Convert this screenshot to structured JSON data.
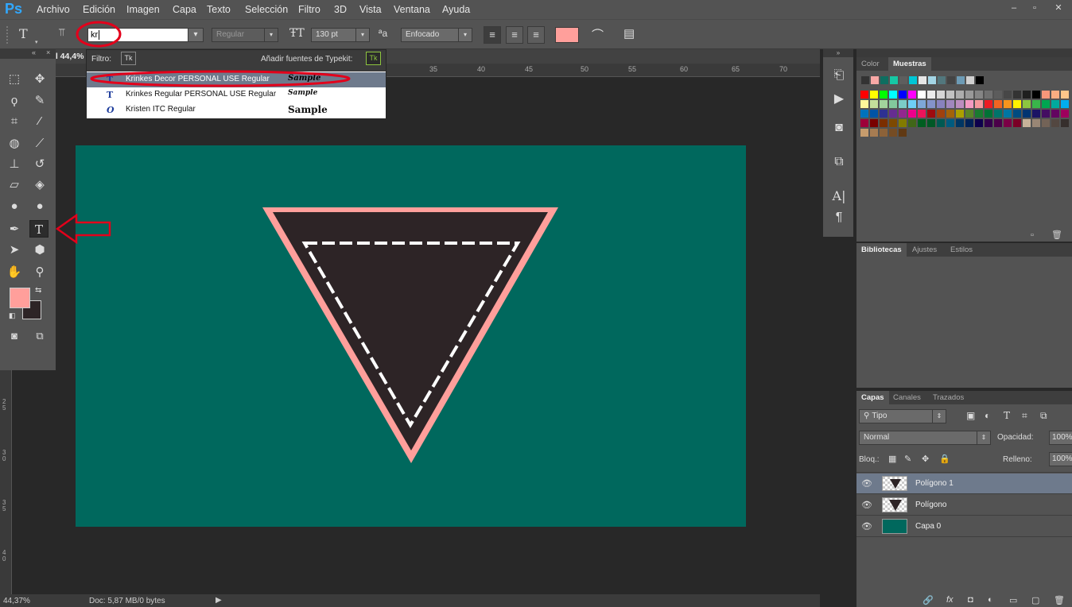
{
  "app": {
    "logo": "Ps"
  },
  "menu": [
    "Archivo",
    "Edición",
    "Imagen",
    "Capa",
    "Texto",
    "Selección",
    "Filtro",
    "3D",
    "Vista",
    "Ventana",
    "Ayuda"
  ],
  "window_controls": [
    "–",
    "▫",
    "✕"
  ],
  "options": {
    "tool_icon": "T",
    "font_input_value": "kr",
    "font_style": "Regular",
    "font_size": "130 pt",
    "aa_label": "ªa",
    "antialias": "Enfocado",
    "text_color": "#ff9f9b"
  },
  "doc_tab": {
    "title": "al 44,4%"
  },
  "font_popup": {
    "filter_label": "Filtro:",
    "typekit_label": "Añadir fuentes de Typekit:",
    "tk": "Tk",
    "fonts": [
      {
        "icon": "T",
        "name": "Krinkes Decor PERSONAL USE Regular",
        "sample": "Sample",
        "selected": true
      },
      {
        "icon": "T",
        "name": "Krinkes Regular PERSONAL USE Regular",
        "sample": "Sample",
        "selected": false
      },
      {
        "icon": "O",
        "name": "Kristen ITC Regular",
        "sample": "Sample",
        "selected": false
      }
    ]
  },
  "ruler": {
    "h_ticks": [
      "35",
      "40",
      "45",
      "50",
      "55",
      "60",
      "65",
      "70"
    ],
    "v_ticks": [
      "2\n5",
      "3\n0",
      "3\n5",
      "4\n0"
    ]
  },
  "colors": {
    "foreground": "#ff9f9b",
    "background": "#2d2426",
    "canvas": "#00685d",
    "triangle_outer": "#ff9f9b",
    "triangle_inner": "#2d2426",
    "selected_row": "#6e7a8c",
    "annotation_red": "#e3001b"
  },
  "status": {
    "zoom": "44,37%",
    "doc": "Doc: 5,87 MB/0 bytes"
  },
  "swatch_panel": {
    "tabs": [
      "Color",
      "Muestras"
    ]
  },
  "library_panel": {
    "tabs": [
      "Bibliotecas",
      "Ajustes",
      "Estilos"
    ]
  },
  "layers_panel": {
    "tabs": [
      "Capas",
      "Canales",
      "Trazados"
    ],
    "filter_kind": "Tipo",
    "blend_mode": "Normal",
    "opacity_label": "Opacidad:",
    "opacity_value": "100%",
    "lock_label": "Bloq.:",
    "fill_label": "Relleno:",
    "fill_value": "100%",
    "layers": [
      {
        "name": "Polígono 1",
        "selected": true
      },
      {
        "name": "Polígono",
        "selected": false
      },
      {
        "name": "Capa 0",
        "selected": false
      }
    ],
    "footer_icons": [
      "🔗",
      "fx",
      "◘",
      "◐",
      "▭",
      "▢",
      "🗑"
    ]
  }
}
